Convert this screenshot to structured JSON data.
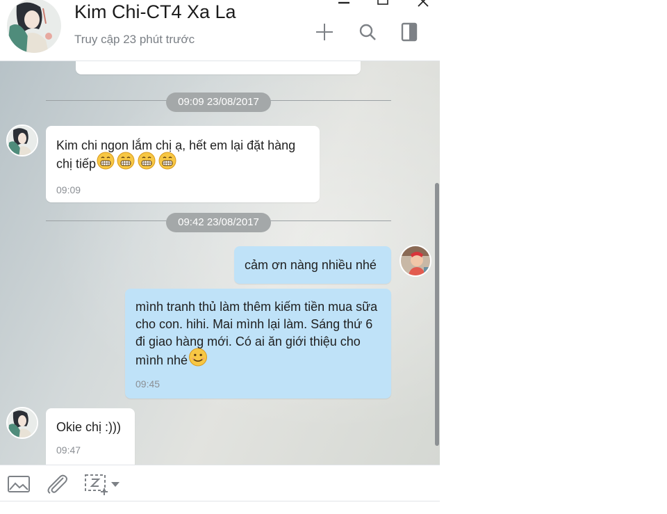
{
  "header": {
    "contact_name": "Kim Chi-CT4 Xa La",
    "contact_status": "Truy cập 23 phút trước",
    "icons": [
      "add-icon",
      "search-icon",
      "sidebar-toggle-icon"
    ],
    "window_controls": [
      "minimize-icon",
      "maximize-icon",
      "close-icon"
    ]
  },
  "chat": {
    "separators": [
      {
        "label": "09:09 23/08/2017"
      },
      {
        "label": "09:42 23/08/2017"
      }
    ],
    "messages": [
      {
        "direction": "in",
        "text": "Kim chi ngon lắm chị ạ, hết em lại đặt hàng chị tiếp",
        "emoji": [
          "grin-emoji",
          "grin-emoji",
          "grin-emoji",
          "grin-emoji"
        ],
        "time": "09:09"
      },
      {
        "direction": "out",
        "text": "cảm ơn nàng nhiều nhé",
        "time": ""
      },
      {
        "direction": "out",
        "text": "mình tranh thủ làm thêm kiếm tiền mua sữa cho con. hihi. Mai mình lại làm. Sáng thứ 6 đi giao hàng mới. Có ai ăn giới thiệu cho mình nhé",
        "emoji": [
          "smile-emoji"
        ],
        "time": "09:45"
      },
      {
        "direction": "in",
        "text": "Okie chị :)))",
        "time": "09:47"
      }
    ]
  },
  "composer": {
    "tools": [
      "image-icon",
      "attachment-icon",
      "screenshot-icon",
      "dropdown-caret-icon"
    ],
    "placeholder": ""
  },
  "colors": {
    "incoming_bubble": "#ffffff",
    "outgoing_bubble": "#bfe2f8",
    "date_pill": "#a4a8a9",
    "icon": "#7d8186"
  }
}
